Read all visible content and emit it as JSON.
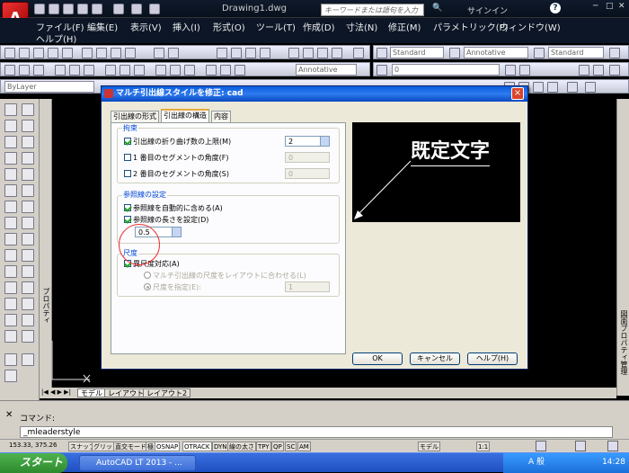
{
  "app": {
    "logo": "A",
    "document_title": "Drawing1.dwg",
    "search_placeholder": "キーワードまたは語句を入力",
    "signin": "サインイン",
    "help_icon": "?"
  },
  "menubar": {
    "items": [
      "ファイル(F)",
      "編集(E)",
      "表示(V)",
      "挿入(I)",
      "形式(O)",
      "ツール(T)",
      "作成(D)",
      "寸法(N)",
      "修正(M)",
      "パラメトリック(P)",
      "ウィンドウ(W)",
      "ヘルプ(H)"
    ]
  },
  "toolbars": {
    "textstyle": "Standard",
    "annotative": "Annotative",
    "tablestyle": "Standard",
    "annotative2": "Annotative",
    "layer": "ByLayer",
    "layer_value": "0"
  },
  "left_panel": {
    "properties_label": "プロパティ"
  },
  "right_panel": {
    "label": "図面プロパティ管理"
  },
  "layout_tabs": [
    "モデル",
    "レイアウト1",
    "レイアウト2"
  ],
  "command": {
    "history_label": "コマンド:",
    "current": "_mleaderstyle"
  },
  "status": {
    "coords": "153.33, 375.26",
    "toggles": [
      "スナップ",
      "グリッド",
      "直交モード",
      "極",
      "OSNAP",
      "OTRACK",
      "DYN",
      "線の太さ",
      "TPY",
      "QP",
      "SC",
      "AM"
    ],
    "model": "モデル",
    "scale": "1:1"
  },
  "taskbar": {
    "start": "スタート",
    "item": "AutoCAD LT 2013 - ...",
    "ime": "A 般",
    "time": "14:28"
  },
  "dialog": {
    "title": "マルチ引出線スタイルを修正: cad",
    "tabs": [
      "引出線の形式",
      "引出線の構造",
      "内容"
    ],
    "selected_tab": "引出線の構造",
    "constraints": {
      "title": "拘束",
      "max_points": {
        "label": "引出線の折り曲げ数の上限(M)",
        "checked": true,
        "value": "2"
      },
      "first_seg": {
        "label": "1 番目のセグメントの角度(F)",
        "checked": false,
        "value": "0"
      },
      "second_seg": {
        "label": "2 番目のセグメントの角度(S)",
        "checked": false,
        "value": "0"
      }
    },
    "landing": {
      "title": "参照線の設定",
      "auto_include": {
        "label": "参照線を自動的に含める(A)",
        "checked": true
      },
      "set_distance": {
        "label": "参照線の長さを設定(D)",
        "checked": true
      },
      "distance_value": "0.5"
    },
    "scale": {
      "title": "尺度",
      "annotative": {
        "label": "異尺度対応(A)",
        "checked": true
      },
      "fit_layout": {
        "label": "マルチ引出線の尺度をレイアウトに合わせる(L)",
        "selected": false
      },
      "specify": {
        "label": "尺度を指定(E):",
        "selected": true,
        "value": "1"
      }
    },
    "preview_text": "既定文字",
    "buttons": {
      "ok": "OK",
      "cancel": "キャンセル",
      "help": "ヘルプ(H)"
    },
    "close_label": "×"
  }
}
